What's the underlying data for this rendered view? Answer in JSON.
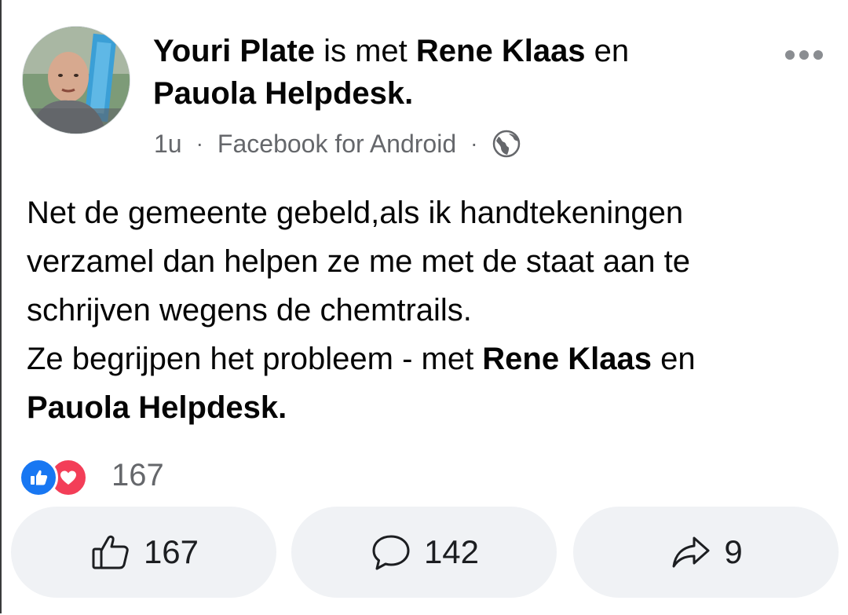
{
  "post": {
    "author": "Youri Plate",
    "with_text": " is met ",
    "tag1": "Rene Klaas",
    "and_text": " en ",
    "tag2": "Pauola Helpdesk.",
    "time": "1u",
    "source": "Facebook for Android",
    "meta_sep": "·",
    "body": {
      "line1": "Net de gemeente gebeld,als ik  handtekeningen",
      "line2": "verzamel dan helpen ze me met de staat aan te",
      "line3": "schrijven wegens de chemtrails.",
      "line4_pre": "Ze begrijpen het probleem - met ",
      "line4_tag1": "Rene Klaas",
      "line4_and": " en",
      "line5_tag2": "Pauola Helpdesk."
    }
  },
  "reactions": {
    "count": "167",
    "types": [
      "like-icon",
      "love-icon"
    ],
    "like_color": "#1877f2",
    "love_color": "#f33e58"
  },
  "actions": {
    "like_count": "167",
    "comment_count": "142",
    "share_count": "9"
  },
  "icons": {
    "more": "more-options-icon",
    "audience": "globe-icon",
    "like": "thumbs-up-icon",
    "comment": "comment-bubble-icon",
    "share": "share-arrow-icon"
  }
}
